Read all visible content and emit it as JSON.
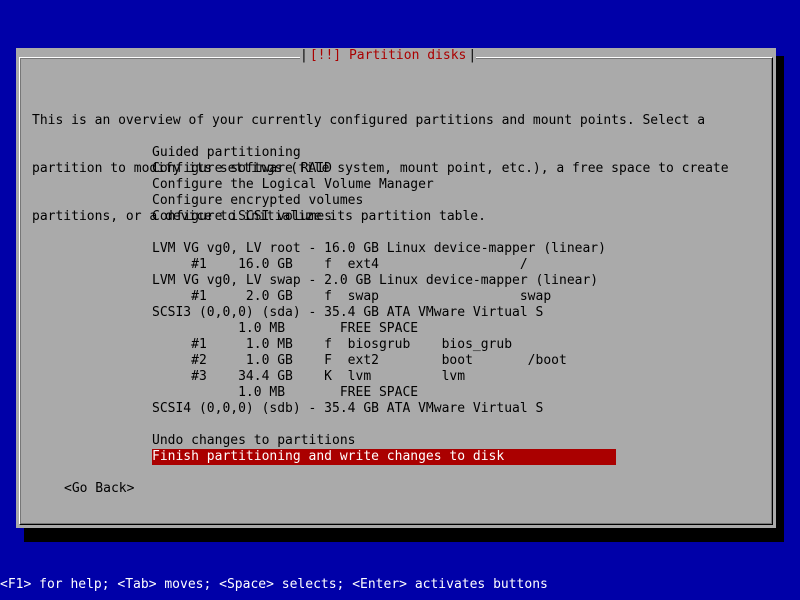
{
  "dialog": {
    "title": "[!!] Partition disks",
    "title_text": "[!!] Partition disks",
    "description": [
      "This is an overview of your currently configured partitions and mount points. Select a",
      "partition to modify its settings (file system, mount point, etc.), a free space to create",
      "partitions, or a device to initialize its partition table."
    ]
  },
  "menu": {
    "config_items": [
      "Guided partitioning",
      "Configure software RAID",
      "Configure the Logical Volume Manager",
      "Configure encrypted volumes",
      "Configure iSCSI volumes"
    ],
    "partition_items": [
      "LVM VG vg0, LV root - 16.0 GB Linux device-mapper (linear)",
      "     #1    16.0 GB    f  ext4                  /",
      "LVM VG vg0, LV swap - 2.0 GB Linux device-mapper (linear)",
      "     #1     2.0 GB    f  swap                  swap",
      "SCSI3 (0,0,0) (sda) - 35.4 GB ATA VMware Virtual S",
      "           1.0 MB       FREE SPACE",
      "     #1     1.0 MB    f  biosgrub    bios_grub",
      "     #2     1.0 GB    F  ext2        boot       /boot",
      "     #3    34.4 GB    K  lvm         lvm",
      "           1.0 MB       FREE SPACE",
      "SCSI4 (0,0,0) (sdb) - 35.4 GB ATA VMware Virtual S"
    ],
    "action_items": [
      "Undo changes to partitions",
      "Finish partitioning and write changes to disk"
    ],
    "selected_action_index": 1
  },
  "buttons": {
    "go_back": "<Go Back>"
  },
  "footer": {
    "help_text": "<F1> for help; <Tab> moves; <Space> selects; <Enter> activates buttons"
  },
  "colors": {
    "background": "#0000a8",
    "dialog": "#aaaaaa",
    "title": "#aa0000",
    "selection": "#aa0000",
    "footer_text": "#ffffff"
  }
}
